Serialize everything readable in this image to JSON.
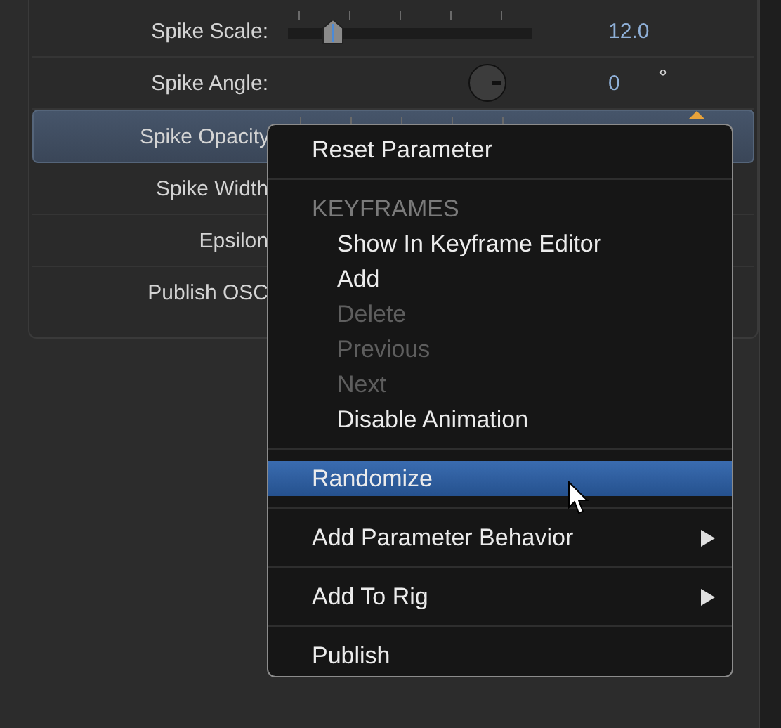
{
  "parameters": [
    {
      "label": "Spike Scale:",
      "kind": "slider",
      "level": 0.15,
      "value": "12.0",
      "selected": false
    },
    {
      "label": "Spike Angle:",
      "kind": "dial",
      "value": "0",
      "unit": "°",
      "selected": false
    },
    {
      "label": "Spike Opacity",
      "kind": "ticks",
      "selected": true,
      "keyframed": true
    },
    {
      "label": "Spike Width",
      "kind": "plain",
      "selected": false
    },
    {
      "label": "Epsilon",
      "kind": "plain",
      "selected": false
    },
    {
      "label": "Publish OSC",
      "kind": "plain",
      "selected": false
    }
  ],
  "context_menu": {
    "sections": [
      {
        "items": [
          {
            "label": "Reset Parameter",
            "disabled": false,
            "selected": false,
            "submenu": false
          }
        ]
      },
      {
        "header": "KEYFRAMES",
        "items": [
          {
            "label": "Show In Keyframe Editor",
            "disabled": false,
            "selected": false,
            "submenu": false
          },
          {
            "label": "Add",
            "disabled": false,
            "selected": false,
            "submenu": false
          },
          {
            "label": "Delete",
            "disabled": true,
            "selected": false,
            "submenu": false
          },
          {
            "label": "Previous",
            "disabled": true,
            "selected": false,
            "submenu": false
          },
          {
            "label": "Next",
            "disabled": true,
            "selected": false,
            "submenu": false
          },
          {
            "label": "Disable Animation",
            "disabled": false,
            "selected": false,
            "submenu": false
          }
        ]
      },
      {
        "items": [
          {
            "label": "Randomize",
            "disabled": false,
            "selected": true,
            "submenu": false
          }
        ]
      },
      {
        "items": [
          {
            "label": "Add Parameter Behavior",
            "disabled": false,
            "selected": false,
            "submenu": true
          }
        ]
      },
      {
        "items": [
          {
            "label": "Add To Rig",
            "disabled": false,
            "selected": false,
            "submenu": true
          }
        ]
      },
      {
        "items": [
          {
            "label": "Publish",
            "disabled": false,
            "selected": false,
            "submenu": false
          }
        ]
      }
    ]
  }
}
